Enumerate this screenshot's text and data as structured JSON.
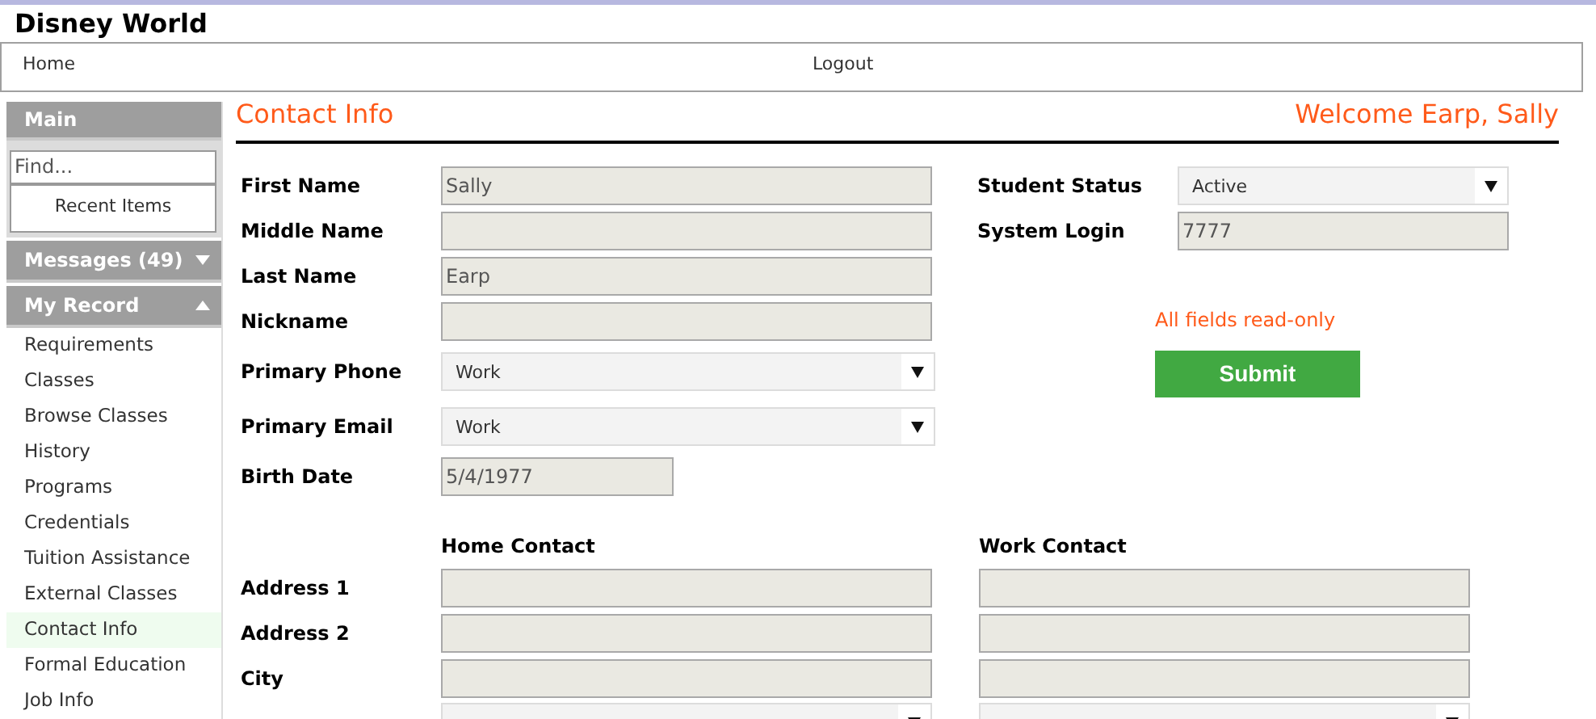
{
  "app_title": "Disney World",
  "nav": [
    {
      "label": "Home"
    },
    {
      "label": "Logout"
    }
  ],
  "sidebar": {
    "header": "Main",
    "search_placeholder": "Find...",
    "recent_items": "Recent Items",
    "sections": [
      {
        "label": "Messages (49)",
        "expanded": false
      },
      {
        "label": "My Record",
        "expanded": true,
        "items": [
          {
            "label": "Requirements",
            "selected": false
          },
          {
            "label": "Classes",
            "selected": false
          },
          {
            "label": "Browse Classes",
            "selected": false
          },
          {
            "label": "History",
            "selected": false
          },
          {
            "label": "Programs",
            "selected": false
          },
          {
            "label": "Credentials",
            "selected": false
          },
          {
            "label": "Tuition Assistance",
            "selected": false
          },
          {
            "label": "External Classes",
            "selected": false
          },
          {
            "label": "Contact Info",
            "selected": true
          },
          {
            "label": "Formal Education",
            "selected": false
          },
          {
            "label": "Job Info",
            "selected": false
          }
        ]
      }
    ]
  },
  "page": {
    "title": "Contact Info",
    "welcome": "Welcome Earp, Sally"
  },
  "left_fields": [
    {
      "label": "First Name",
      "kind": "text",
      "value": "Sally"
    },
    {
      "label": "Middle Name",
      "kind": "text"
    },
    {
      "label": "Last Name",
      "kind": "text",
      "value": "Earp"
    },
    {
      "label": "Nickname",
      "kind": "text"
    },
    {
      "label": "Primary Phone",
      "kind": "select",
      "value": "Work"
    },
    {
      "label": "Primary Email",
      "kind": "select",
      "value": "Work"
    },
    {
      "label": "Birth Date",
      "kind": "date",
      "value": "5/4/1977"
    }
  ],
  "right_fields": [
    {
      "label": "Student Status",
      "kind": "select",
      "value": "Active"
    },
    {
      "label": "System Login",
      "kind": "text",
      "value": "7777"
    }
  ],
  "note": "All fields read-only",
  "submit": "Submit",
  "contact": {
    "columns": [
      "Home Contact",
      "Work Contact"
    ],
    "rows": [
      {
        "label": "Address 1",
        "kind": "text"
      },
      {
        "label": "Address 2",
        "kind": "text"
      },
      {
        "label": "City",
        "kind": "text"
      },
      {
        "kind": "select"
      }
    ]
  }
}
